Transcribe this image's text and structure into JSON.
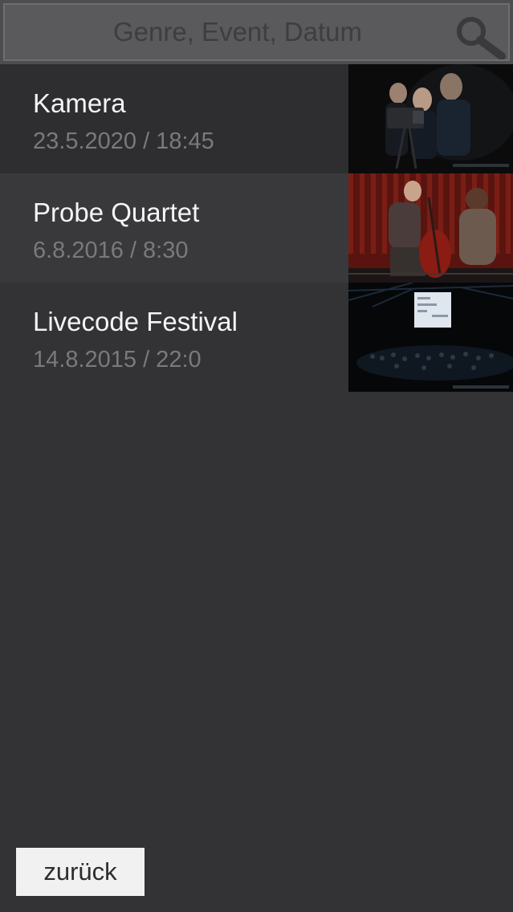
{
  "search": {
    "placeholder": "Genre, Event, Datum",
    "icon": "search-icon"
  },
  "events": [
    {
      "title": "Kamera",
      "date": "23.5.2020 / 18:45",
      "thumbnail": "camera-crew-photo"
    },
    {
      "title": "Probe Quartet",
      "date": "6.8.2016 / 8:30",
      "thumbnail": "cello-rehearsal-photo"
    },
    {
      "title": "Livecode Festival",
      "date": "14.8.2015 / 22:0",
      "thumbnail": "concert-hall-photo"
    }
  ],
  "footer": {
    "back_label": "zurück"
  },
  "colors": {
    "background": "#333235",
    "search_bar": "#4d4c4f",
    "title_text": "#f4f4f4",
    "date_text": "#7a797c",
    "button_bg": "#f1f1f1"
  }
}
